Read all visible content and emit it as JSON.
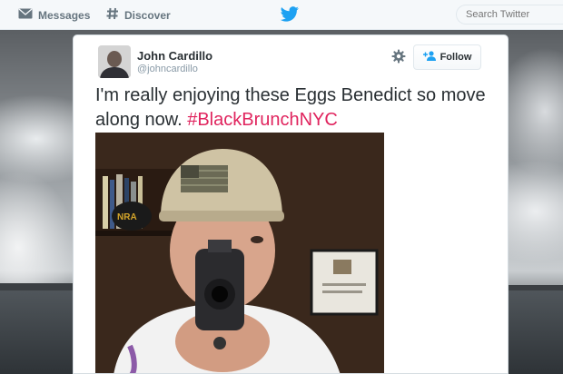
{
  "nav": {
    "messages_label": "Messages",
    "discover_label": "Discover",
    "search_placeholder": "Search Twitter"
  },
  "tweet": {
    "author_name": "John Cardillo",
    "author_handle": "@johncardillo",
    "follow_label": "Follow",
    "text_plain": "I'm really enjoying these Eggs Benedict so move along now. ",
    "hashtag": "#BlackBrunchNYC"
  },
  "colors": {
    "brand": "#1da1f2",
    "hashtag": "#e0245e",
    "text": "#292f33",
    "muted": "#8899a6"
  },
  "icons": {
    "messages": "envelope-icon",
    "discover": "hashtag-icon",
    "brand": "twitter-bird-icon",
    "settings": "gear-icon",
    "follow": "add-user-icon"
  }
}
